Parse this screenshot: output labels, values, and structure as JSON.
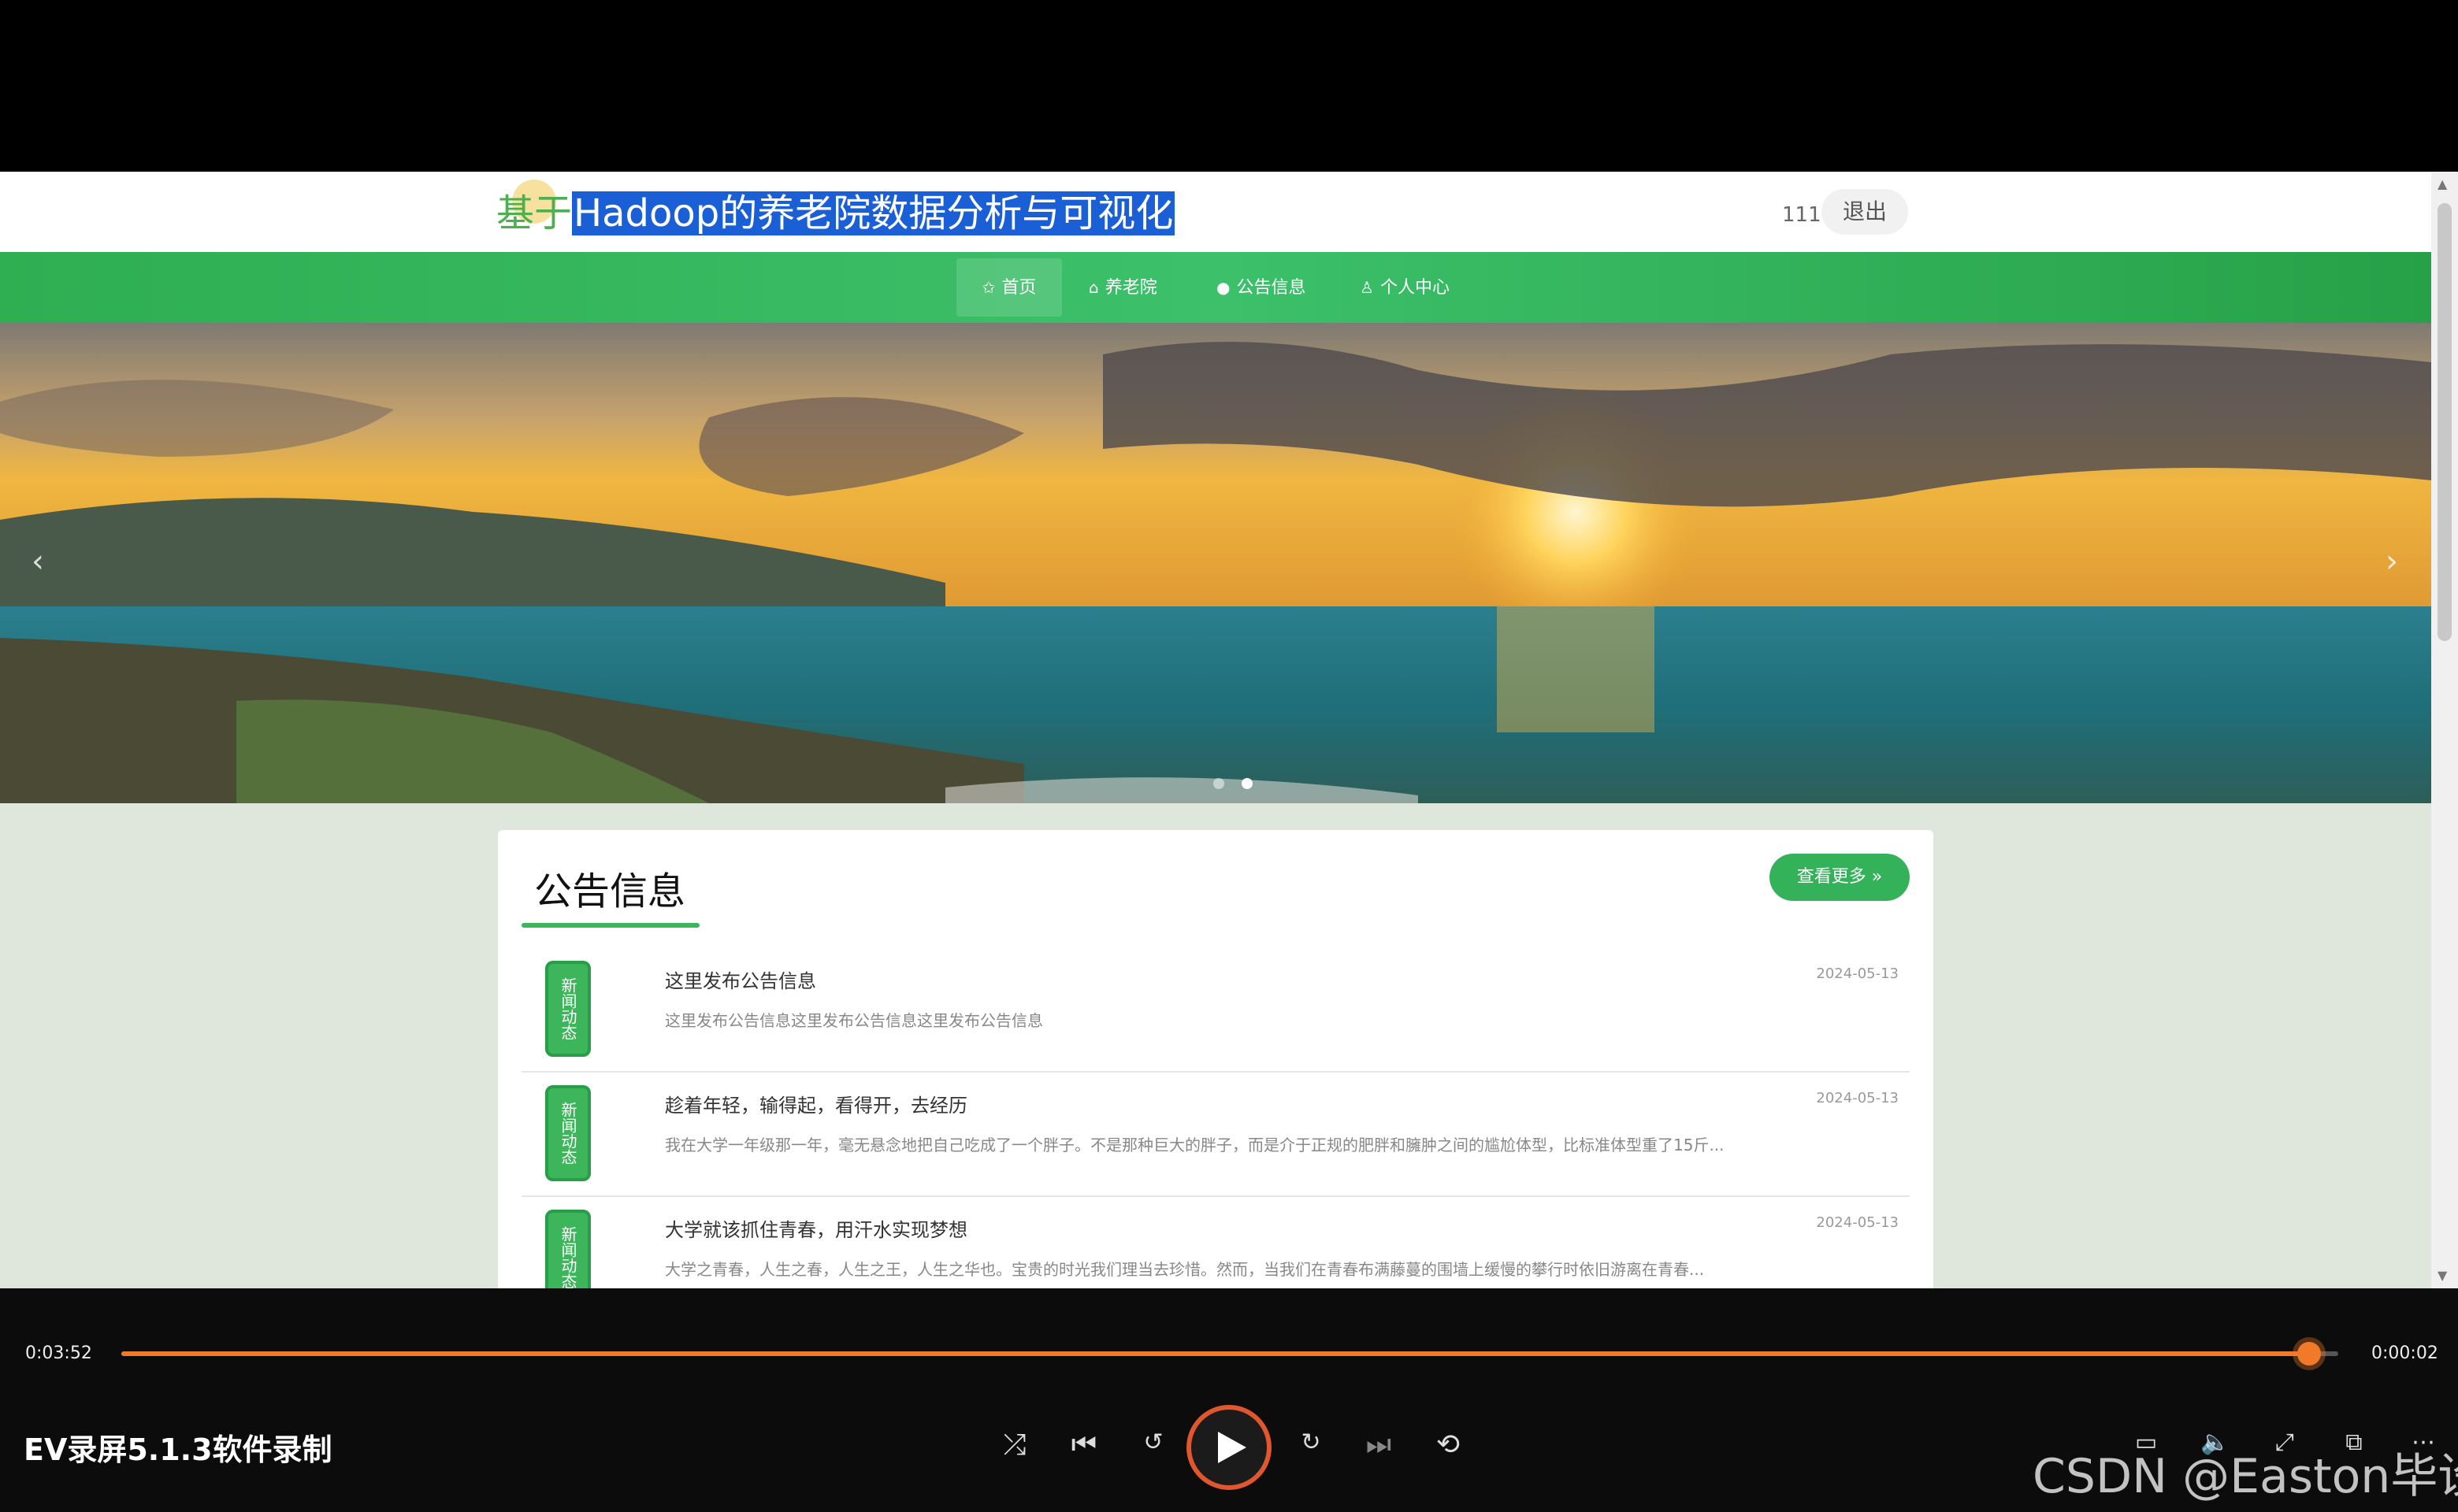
{
  "site": {
    "title_prefix": "基于",
    "title_selected": "Hadoop的养老院数据分析与可视化",
    "username": "111",
    "logout_label": "退出"
  },
  "nav": {
    "items": [
      {
        "icon": "home-icon",
        "label": "首页"
      },
      {
        "icon": "building-icon",
        "label": "养老院"
      },
      {
        "icon": "circle-icon",
        "label": "公告信息"
      },
      {
        "icon": "user-icon",
        "label": "个人中心"
      }
    ]
  },
  "hero": {
    "prev": "‹",
    "next": "›"
  },
  "notice": {
    "title": "公告信息",
    "more_label": "查看更多 »",
    "badge_text": "新闻动态",
    "items": [
      {
        "title": "这里发布公告信息",
        "date": "2024-05-13",
        "desc": "这里发布公告信息这里发布公告信息这里发布公告信息"
      },
      {
        "title": "趁着年轻，输得起，看得开，去经历",
        "date": "2024-05-13",
        "desc": "我在大学一年级那一年，毫无悬念地把自己吃成了一个胖子。不是那种巨大的胖子，而是介于正规的肥胖和臃肿之间的尴尬体型，比标准体型重了15斤..."
      },
      {
        "title": "大学就该抓住青春，用汗水实现梦想",
        "date": "2024-05-13",
        "desc": "大学之青春，人生之春，人生之王，人生之华也。宝贵的时光我们理当去珍惜。然而，当我们在青春布满藤蔓的围墙上缓慢的攀行时依旧游离在青春..."
      }
    ]
  },
  "player": {
    "current_time": "0:03:52",
    "remaining_time": "0:00:02",
    "progress": 0.987,
    "video_title": "EV录屏5.1.3软件录制",
    "watermark": "CSDN @Easton毕设",
    "accent_color": "#f07a2a"
  }
}
